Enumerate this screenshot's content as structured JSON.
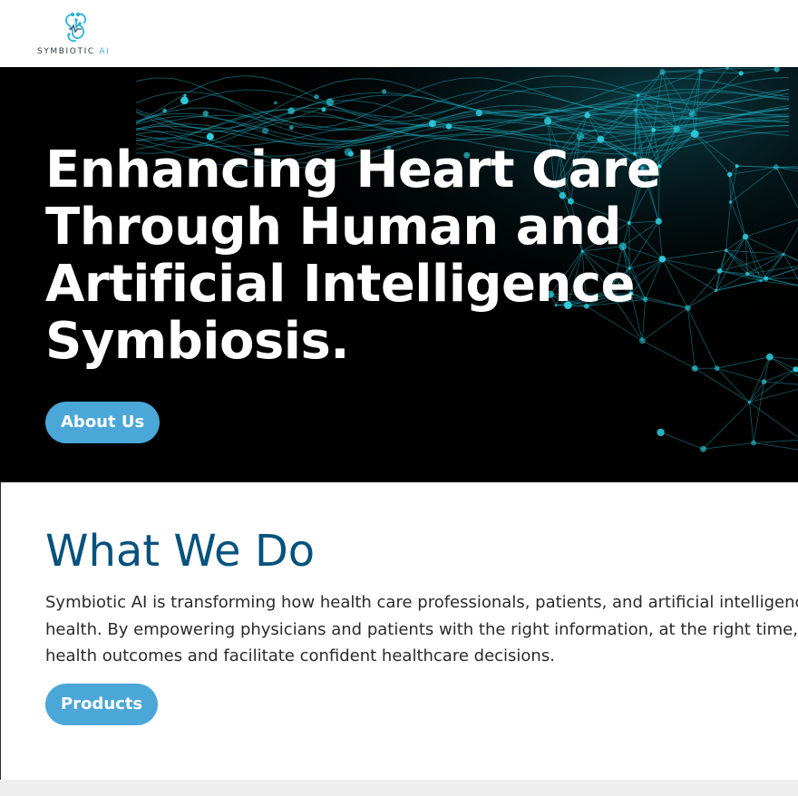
{
  "header": {
    "logo_text": "SYMBIOTIC",
    "logo_text_accent": "AI"
  },
  "hero": {
    "title_lines": [
      "Enhancing Heart Care",
      "Through Human and",
      "Artificial Intelligence",
      "Symbiosis."
    ],
    "about_button": "About Us"
  },
  "what_we_do": {
    "title": "What We Do",
    "body_lines": [
      "Symbiotic AI is transforming how health care professionals, patients, and artificial intelligence w",
      "health. By empowering physicians and patients with the right information, at the right time, our",
      "health outcomes and facilitate confident healthcare decisions."
    ],
    "products_button": "Products"
  },
  "colors": {
    "accent": "#4aa7d8",
    "heading_blue": "#07527d",
    "hero_bg": "#000000",
    "network_cyan": "#19c4d6"
  },
  "icons": {
    "logo": "heart-circuit-icon"
  }
}
